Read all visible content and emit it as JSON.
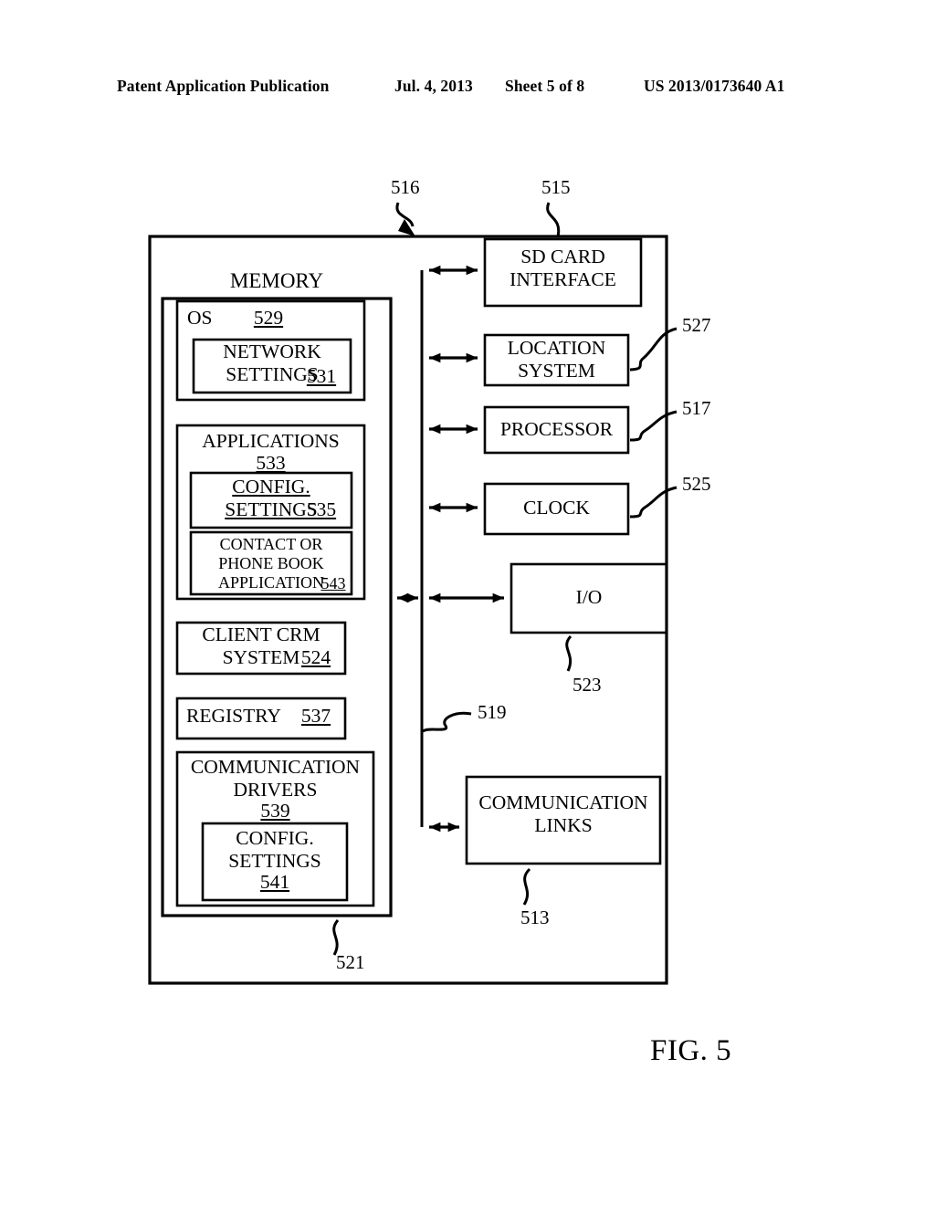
{
  "header": {
    "publication": "Patent Application Publication",
    "date": "Jul. 4, 2013",
    "sheet": "Sheet 5 of 8",
    "us_number": "US 2013/0173640 A1"
  },
  "figure": {
    "caption": "FIG. 5",
    "memory_title": "MEMORY",
    "blocks": {
      "os": {
        "label": "OS",
        "ref": "529"
      },
      "network_settings": {
        "label": "NETWORK\nSETTINGS",
        "ref": "531"
      },
      "applications": {
        "label": "APPLICATIONS",
        "ref": "533"
      },
      "config_settings_app": {
        "label": "CONFIG.\nSETTINGS",
        "ref": "535"
      },
      "contact_phone_book": {
        "label": "CONTACT OR\nPHONE BOOK\nAPPLICATION",
        "ref": "543"
      },
      "client_crm": {
        "label": "CLIENT CRM\nSYSTEM",
        "ref": "524"
      },
      "registry": {
        "label": "REGISTRY",
        "ref": "537"
      },
      "communication_drivers": {
        "label": "COMMUNICATION\nDRIVERS",
        "ref": "539"
      },
      "config_settings_drivers": {
        "label": "CONFIG.\nSETTINGS",
        "ref": "541"
      },
      "sd_card_interface": {
        "label": "SD CARD\nINTERFACE",
        "ref": "515"
      },
      "location_system": {
        "label": "LOCATION\nSYSTEM",
        "ref": "527"
      },
      "processor": {
        "label": "PROCESSOR",
        "ref": "517"
      },
      "clock": {
        "label": "CLOCK",
        "ref": "525"
      },
      "io": {
        "label": "I/O",
        "ref": "523"
      },
      "communication_links": {
        "label": "COMMUNICATION\nLINKS",
        "ref": "513"
      }
    },
    "reference_numerals": {
      "device": "516",
      "sd_card": "515",
      "location_system": "527",
      "processor": "517",
      "clock": "525",
      "io": "523",
      "bus": "519",
      "memory": "521",
      "communication_links": "513"
    }
  }
}
